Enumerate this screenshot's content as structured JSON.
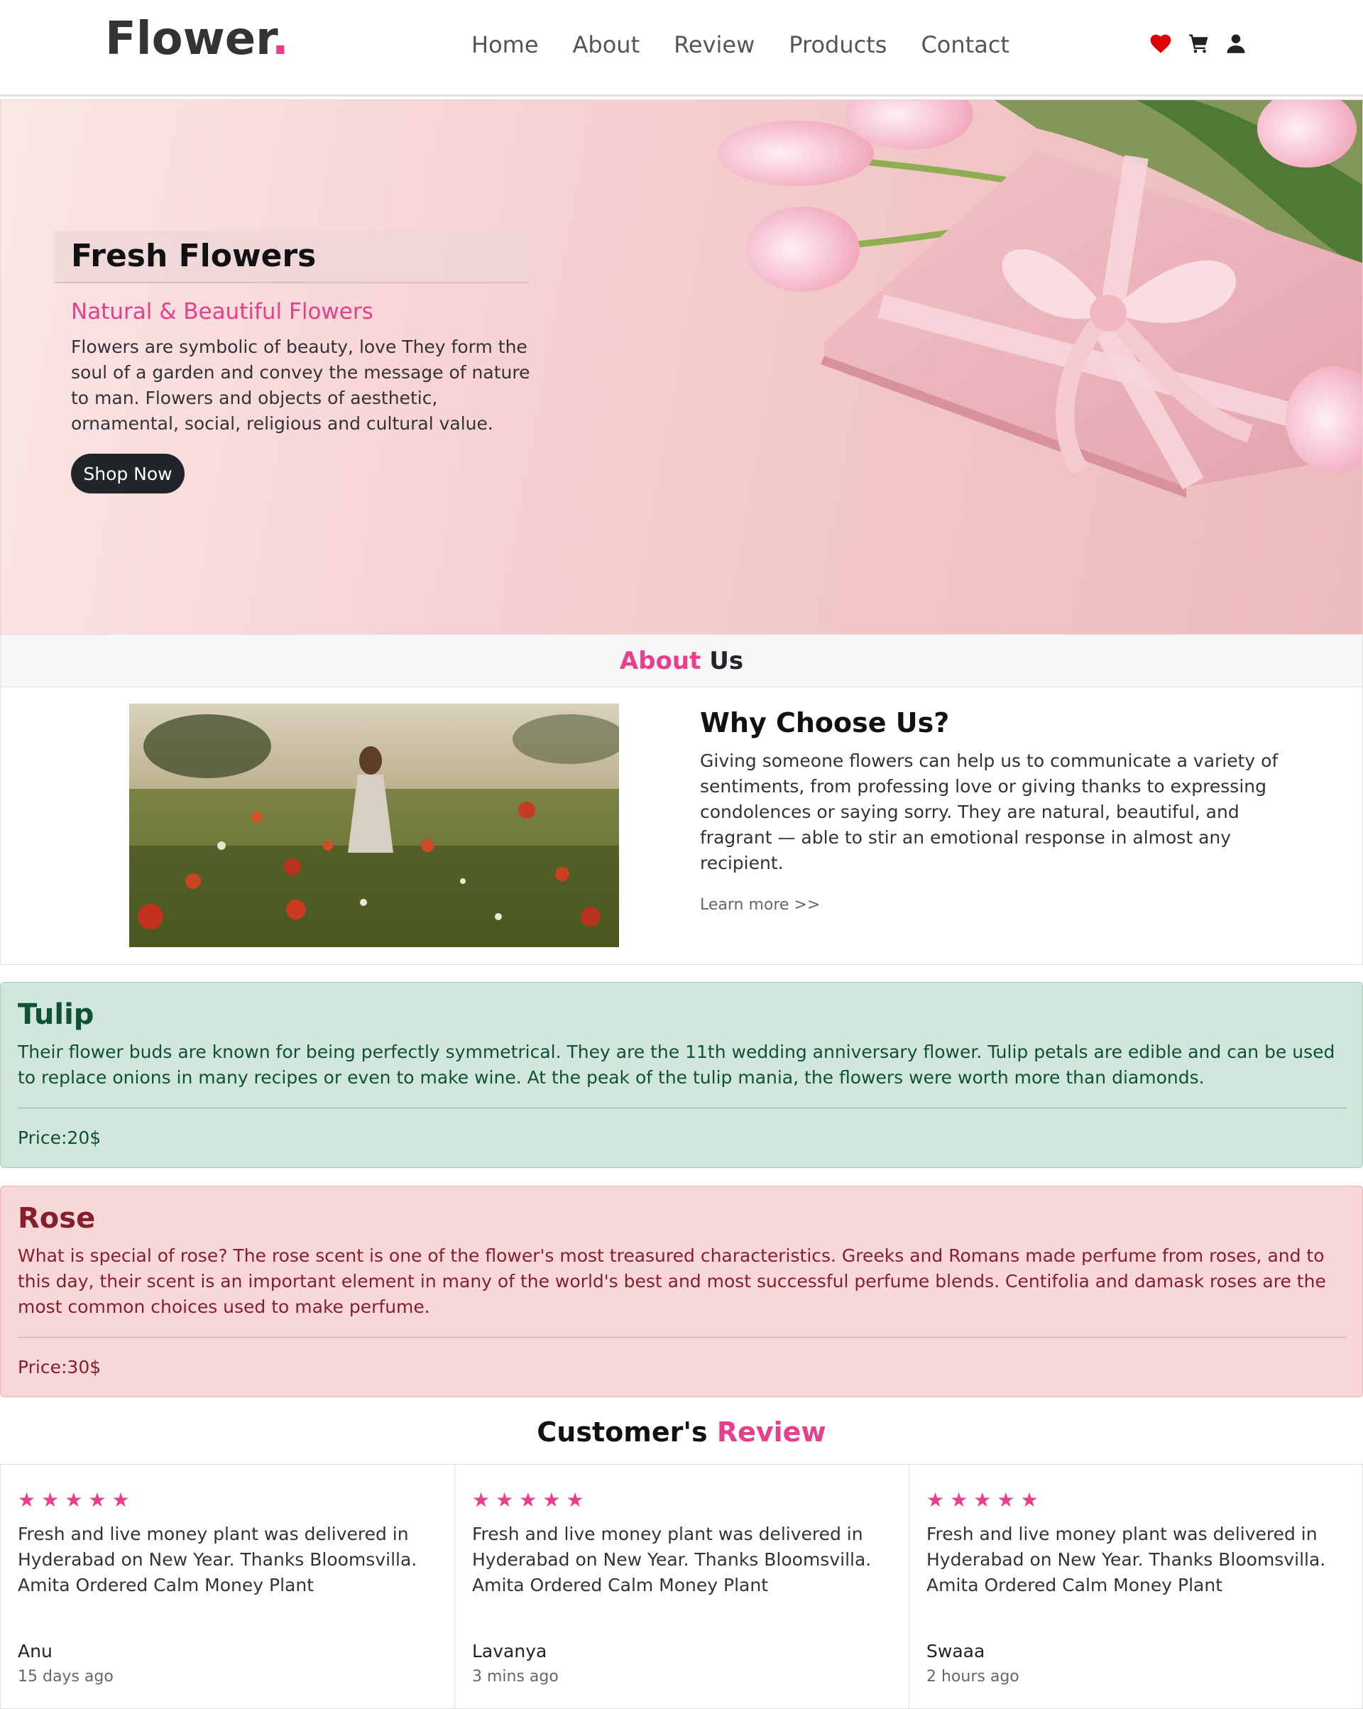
{
  "header": {
    "logo_text": "Flower",
    "logo_dot": ".",
    "nav": [
      "Home",
      "About",
      "Review",
      "Products",
      "Contact"
    ],
    "icons": [
      "heart-icon",
      "cart-icon",
      "user-icon"
    ]
  },
  "hero": {
    "title": "Fresh Flowers",
    "subtitle": "Natural & Beautiful Flowers",
    "text": "Flowers are symbolic of beauty, love They form the soul of a garden and convey the message of nature to man. Flowers and objects of aesthetic, ornamental, social, religious and cultural value.",
    "button": "Shop Now"
  },
  "about": {
    "heading_accent": "About",
    "heading_rest": " Us",
    "title": "Why Choose Us?",
    "text": "Giving someone flowers can help us to communicate a variety of sentiments, from professing love or giving thanks to expressing condolences or saying sorry. They are natural, beautiful, and fragrant — able to stir an emotional response in almost any recipient.",
    "link": "Learn more >>"
  },
  "products": [
    {
      "name": "Tulip",
      "description": "Their flower buds are known for being perfectly symmetrical. They are the 11th wedding anniversary flower. Tulip petals are edible and can be used to replace onions in many recipes or even to make wine. At the peak of the tulip mania, the flowers were worth more than diamonds.",
      "price": "Price:20$"
    },
    {
      "name": "Rose",
      "description": "What is special of rose? The rose scent is one of the flower's most treasured characteristics. Greeks and Romans made perfume from roses, and to this day, their scent is an important element in many of the world's best and most successful perfume blends. Centifolia and damask roses are the most common choices used to make perfume.",
      "price": "Price:30$"
    }
  ],
  "reviews": {
    "heading_main": "Customer's ",
    "heading_accent": "Review",
    "items": [
      {
        "stars": "★",
        "rating": 5,
        "text": "Fresh and live money plant was delivered in Hyderabad on New Year. Thanks Bloomsvilla. Amita Ordered Calm Money Plant",
        "name": "Anu",
        "time": "15 days ago"
      },
      {
        "stars": "★",
        "rating": 5,
        "text": "Fresh and live money plant was delivered in Hyderabad on New Year. Thanks Bloomsvilla. Amita Ordered Calm Money Plant",
        "name": "Lavanya",
        "time": "3 mins ago"
      },
      {
        "stars": "★",
        "rating": 5,
        "text": "Fresh and live money plant was delivered in Hyderabad on New Year. Thanks Bloomsvilla. Amita Ordered Calm Money Plant",
        "name": "Swaaa",
        "time": "2 hours ago"
      }
    ]
  },
  "colors": {
    "accent": "#e83e8c",
    "dark": "#212529",
    "success_bg": "#d1e7dd",
    "danger_bg": "#f8d7da"
  }
}
